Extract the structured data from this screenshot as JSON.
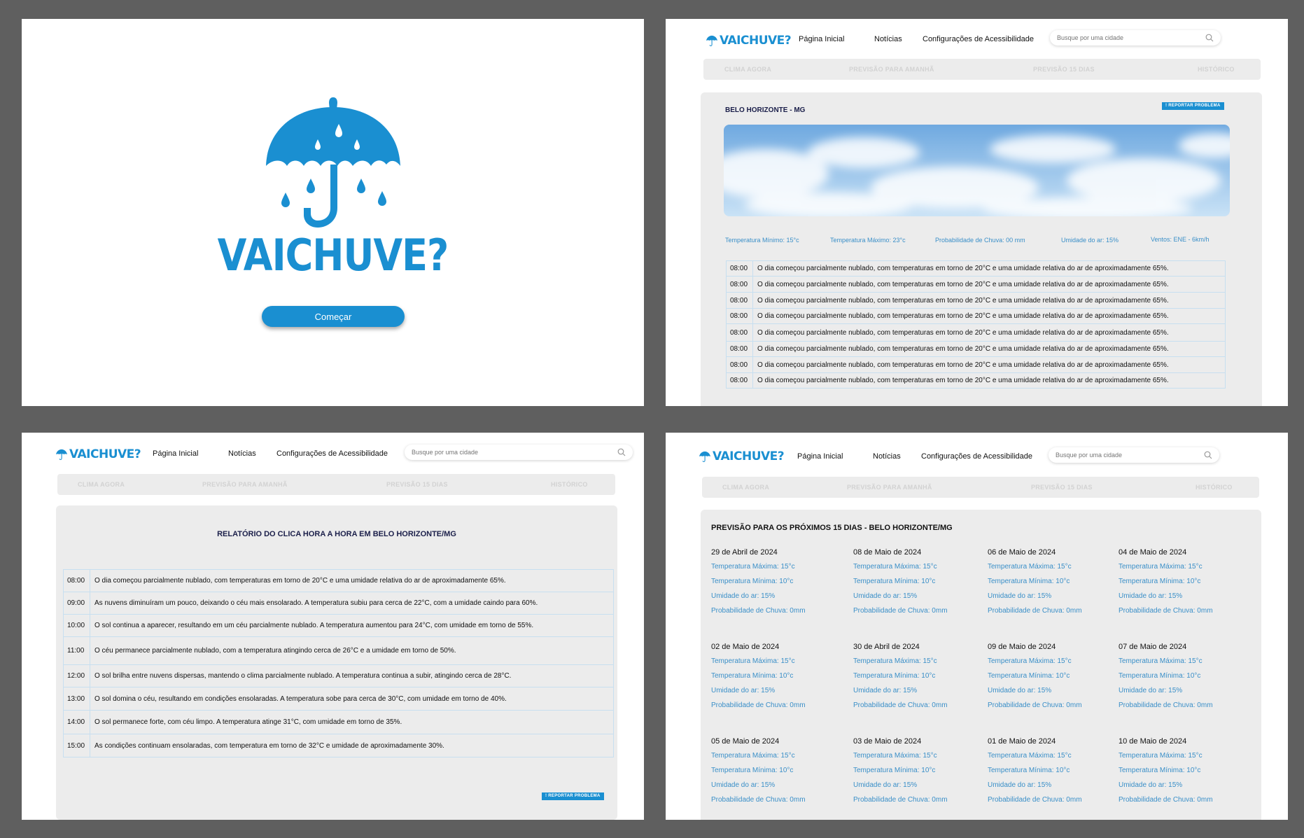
{
  "brand": {
    "name": "VAICHUVE?",
    "color": "#1a8fd1"
  },
  "splash": {
    "title": "VAICHUVE?",
    "start_label": "Começar"
  },
  "nav": {
    "home": "Página Inicial",
    "news": "Notícias",
    "accessibility": "Configurações de Acessibilidade",
    "search_placeholder": "Busque por uma cidade"
  },
  "tabs": [
    "CLIMA AGORA",
    "PREVISÃO PARA AMANHÃ",
    "PREVISÃO 15 DIAS",
    "HISTÓRICO"
  ],
  "current": {
    "city": "BELO HORIZONTE - MG",
    "report_label": "! REPORTAR PROBLEMA",
    "stats": [
      "Temperatura Mínimo: 15°c",
      "Temperatura Máximo: 23°c",
      "Probabilidade de Chuva: 00 mm",
      "Umidade do ar: 15%",
      "Ventos: ENE - 6km/h"
    ],
    "rows": [
      {
        "time": "08:00",
        "text": "O dia começou parcialmente nublado, com temperaturas em torno de 20°C e uma umidade relativa do ar de aproximadamente 65%."
      },
      {
        "time": "08:00",
        "text": "O dia começou parcialmente nublado, com temperaturas em torno de 20°C e uma umidade relativa do ar de aproximadamente 65%."
      },
      {
        "time": "08:00",
        "text": "O dia começou parcialmente nublado, com temperaturas em torno de 20°C e uma umidade relativa do ar de aproximadamente 65%."
      },
      {
        "time": "08:00",
        "text": "O dia começou parcialmente nublado, com temperaturas em torno de 20°C e uma umidade relativa do ar de aproximadamente 65%."
      },
      {
        "time": "08:00",
        "text": "O dia começou parcialmente nublado, com temperaturas em torno de 20°C e uma umidade relativa do ar de aproximadamente 65%."
      },
      {
        "time": "08:00",
        "text": "O dia começou parcialmente nublado, com temperaturas em torno de 20°C e uma umidade relativa do ar de aproximadamente 65%."
      },
      {
        "time": "08:00",
        "text": "O dia começou parcialmente nublado, com temperaturas em torno de 20°C e uma umidade relativa do ar de aproximadamente 65%."
      },
      {
        "time": "08:00",
        "text": "O dia começou parcialmente nublado, com temperaturas em torno de 20°C e uma umidade relativa do ar de aproximadamente 65%."
      }
    ]
  },
  "hourly": {
    "title": "RELATÓRIO DO CLICA HORA A HORA EM BELO HORIZONTE/MG",
    "report_label": "! REPORTAR PROBLEMA",
    "rows": [
      {
        "time": "08:00",
        "text": "O dia começou parcialmente nublado, com temperaturas em torno de 20°C e uma umidade relativa do ar de aproximadamente 65%."
      },
      {
        "time": "09:00",
        "text": "As nuvens diminuíram um pouco, deixando o céu mais ensolarado. A temperatura subiu para cerca de 22°C, com a umidade caindo para 60%."
      },
      {
        "time": "10:00",
        "text": "O sol continua a aparecer, resultando em um céu parcialmente nublado. A temperatura aumentou para 24°C, com umidade em torno de 55%."
      },
      {
        "time": "11:00",
        "text": "O céu permanece parcialmente nublado, com a temperatura atingindo cerca de 26°C e a umidade em torno de 50%."
      },
      {
        "time": "12:00",
        "text": "O sol brilha entre nuvens dispersas, mantendo o clima parcialmente nublado. A temperatura continua a subir, atingindo cerca de 28°C."
      },
      {
        "time": "13:00",
        "text": "O sol domina o céu, resultando em condições ensolaradas. A temperatura sobe para cerca de 30°C, com umidade em torno de 40%."
      },
      {
        "time": "14:00",
        "text": "O sol permanece forte, com céu limpo. A temperatura atinge 31°C, com umidade em torno de 35%."
      },
      {
        "time": "15:00",
        "text": "As condições continuam ensolaradas, com temperatura em torno de 32°C e umidade de aproximadamente 30%."
      }
    ]
  },
  "forecast": {
    "title": "PREVISÃO PARA OS PRÓXIMOS 15 DIAS - BELO HORIZONTE/MG",
    "days": [
      {
        "date": "29 de Abril de 2024",
        "max": "Temperatura Máxima: 15°c",
        "min": "Temperatura Mínima: 10°c",
        "hum": "Umidade do ar: 15%",
        "rain": "Probabilidade de Chuva: 0mm"
      },
      {
        "date": "02 de Maio de 2024",
        "max": "Temperatura Máxima: 15°c",
        "min": "Temperatura Mínima: 10°c",
        "hum": "Umidade do ar: 15%",
        "rain": "Probabilidade de Chuva: 0mm"
      },
      {
        "date": "05 de Maio de 2024",
        "max": "Temperatura Máxima: 15°c",
        "min": "Temperatura Mínima: 10°c",
        "hum": "Umidade do ar: 15%",
        "rain": "Probabilidade de Chuva: 0mm"
      },
      {
        "date": "08 de Maio de 2024",
        "max": "Temperatura Máxima: 15°c",
        "min": "Temperatura Mínima: 10°c",
        "hum": "Umidade do ar: 15%",
        "rain": "Probabilidade de Chuva: 0mm"
      },
      {
        "date": "30 de Abril de 2024",
        "max": "Temperatura Máxima: 15°c",
        "min": "Temperatura Mínima: 10°c",
        "hum": "Umidade do ar: 15%",
        "rain": "Probabilidade de Chuva: 0mm"
      },
      {
        "date": "03 de Maio de 2024",
        "max": "Temperatura Máxima: 15°c",
        "min": "Temperatura Mínima: 10°c",
        "hum": "Umidade do ar: 15%",
        "rain": "Probabilidade de Chuva: 0mm"
      },
      {
        "date": "06 de Maio de 2024",
        "max": "Temperatura Máxima: 15°c",
        "min": "Temperatura Mínima: 10°c",
        "hum": "Umidade do ar: 15%",
        "rain": "Probabilidade de Chuva: 0mm"
      },
      {
        "date": "09 de Maio de 2024",
        "max": "Temperatura Máxima: 15°c",
        "min": "Temperatura Mínima: 10°c",
        "hum": "Umidade do ar: 15%",
        "rain": "Probabilidade de Chuva: 0mm"
      },
      {
        "date": "01 de Maio de 2024",
        "max": "Temperatura Máxima: 15°c",
        "min": "Temperatura Mínima: 10°c",
        "hum": "Umidade do ar: 15%",
        "rain": "Probabilidade de Chuva: 0mm"
      },
      {
        "date": "04 de Maio de 2024",
        "max": "Temperatura Máxima: 15°c",
        "min": "Temperatura Mínima: 10°c",
        "hum": "Umidade do ar: 15%",
        "rain": "Probabilidade de Chuva: 0mm"
      },
      {
        "date": "07 de Maio de 2024",
        "max": "Temperatura Máxima: 15°c",
        "min": "Temperatura Mínima: 10°c",
        "hum": "Umidade do ar: 15%",
        "rain": "Probabilidade de Chuva: 0mm"
      },
      {
        "date": "10 de Maio de 2024",
        "max": "Temperatura Máxima: 15°c",
        "min": "Temperatura Mínima: 10°c",
        "hum": "Umidade do ar: 15%",
        "rain": "Probabilidade de Chuva: 0mm"
      }
    ]
  }
}
